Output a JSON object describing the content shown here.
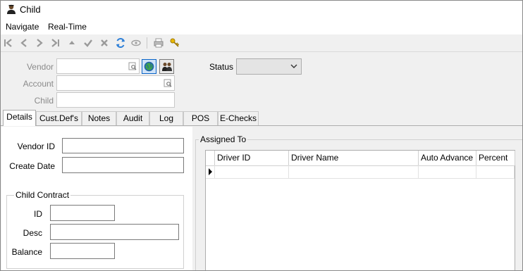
{
  "window": {
    "title": "Child"
  },
  "menu": {
    "items": [
      "Navigate",
      "Real-Time"
    ]
  },
  "toolbar": {
    "icons": [
      "first-record-icon",
      "previous-record-icon",
      "next-record-icon",
      "last-record-icon",
      "move-up-icon",
      "save-check-icon",
      "cancel-x-icon",
      "refresh-icon",
      "view-icon",
      "print-icon",
      "keys-icon"
    ]
  },
  "header": {
    "vendor_label": "Vendor",
    "account_label": "Account",
    "child_label": "Child",
    "status_label": "Status",
    "vendor_value": "",
    "account_value": "",
    "child_value": "",
    "status_value": ""
  },
  "tabs": [
    "Details",
    "Cust.Def's",
    "Notes",
    "Audit",
    "Log",
    "POS",
    "E-Checks"
  ],
  "active_tab": "Details",
  "details": {
    "vendor_id_label": "Vendor ID",
    "create_date_label": "Create Date",
    "vendor_id_value": "",
    "create_date_value": "",
    "contract_group_title": "Child Contract",
    "id_label": "ID",
    "desc_label": "Desc",
    "balance_label": "Balance",
    "id_value": "",
    "desc_value": "",
    "balance_value": ""
  },
  "assigned": {
    "group_title": "Assigned To",
    "columns": [
      "Driver ID",
      "Driver Name",
      "Auto Advance",
      "Percent"
    ],
    "rows": []
  },
  "colors": {
    "accent": "#0a64c8",
    "window_bg": "#f0f0f0",
    "border": "#adadad"
  }
}
